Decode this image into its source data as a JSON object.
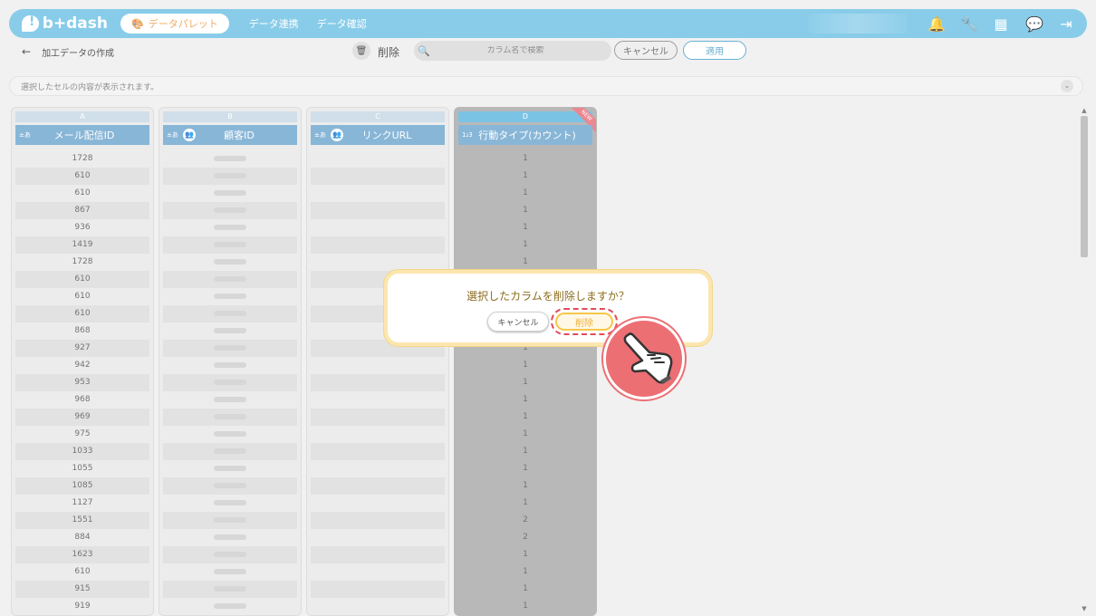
{
  "header": {
    "logo_text": "b+dash",
    "active_section": "データパレット",
    "nav": [
      "データ連携",
      "データ確認"
    ],
    "icons": [
      "bell-icon",
      "wrench-icon",
      "apps-grid-icon",
      "chat-icon",
      "logout-icon"
    ]
  },
  "subbar": {
    "title": "加工データの作成",
    "delete_label": "削除",
    "search_placeholder": "カラム名で検索",
    "cancel_label": "キャンセル",
    "apply_label": "適用"
  },
  "cell_info": {
    "text": "選択したセルの内容が表示されます。"
  },
  "columns": [
    {
      "letter": "A",
      "type_badge": "±あ",
      "name": "メール配信ID",
      "values": [
        "1728",
        "610",
        "610",
        "867",
        "936",
        "1419",
        "1728",
        "610",
        "610",
        "610",
        "868",
        "927",
        "942",
        "953",
        "968",
        "969",
        "975",
        "1033",
        "1055",
        "1085",
        "1127",
        "1551",
        "884",
        "1623",
        "610",
        "915",
        "919"
      ]
    },
    {
      "letter": "B",
      "type_badge": "±あ",
      "name": "顧客ID"
    },
    {
      "letter": "C",
      "type_badge": "±あ",
      "name": "リンクURL"
    },
    {
      "letter": "D",
      "type_badge": "1₂3",
      "name": "行動タイプ(カウント)",
      "new_badge": "NEW",
      "values": [
        "1",
        "1",
        "1",
        "1",
        "1",
        "1",
        "1",
        "1",
        "1",
        "1",
        "1",
        "1",
        "1",
        "1",
        "1",
        "1",
        "1",
        "1",
        "1",
        "1",
        "1",
        "2",
        "2",
        "1",
        "1",
        "1",
        "1"
      ]
    }
  ],
  "modal": {
    "message": "選択したカラムを削除しますか？",
    "cancel_label": "キャンセル",
    "delete_label": "削除"
  },
  "colors": {
    "brand_blue": "#6ec1e4",
    "column_header": "#6ea6cf",
    "modal_border": "#fbe6b0",
    "delete_accent": "#f6c84a",
    "pointer_red": "#ec6f74"
  }
}
